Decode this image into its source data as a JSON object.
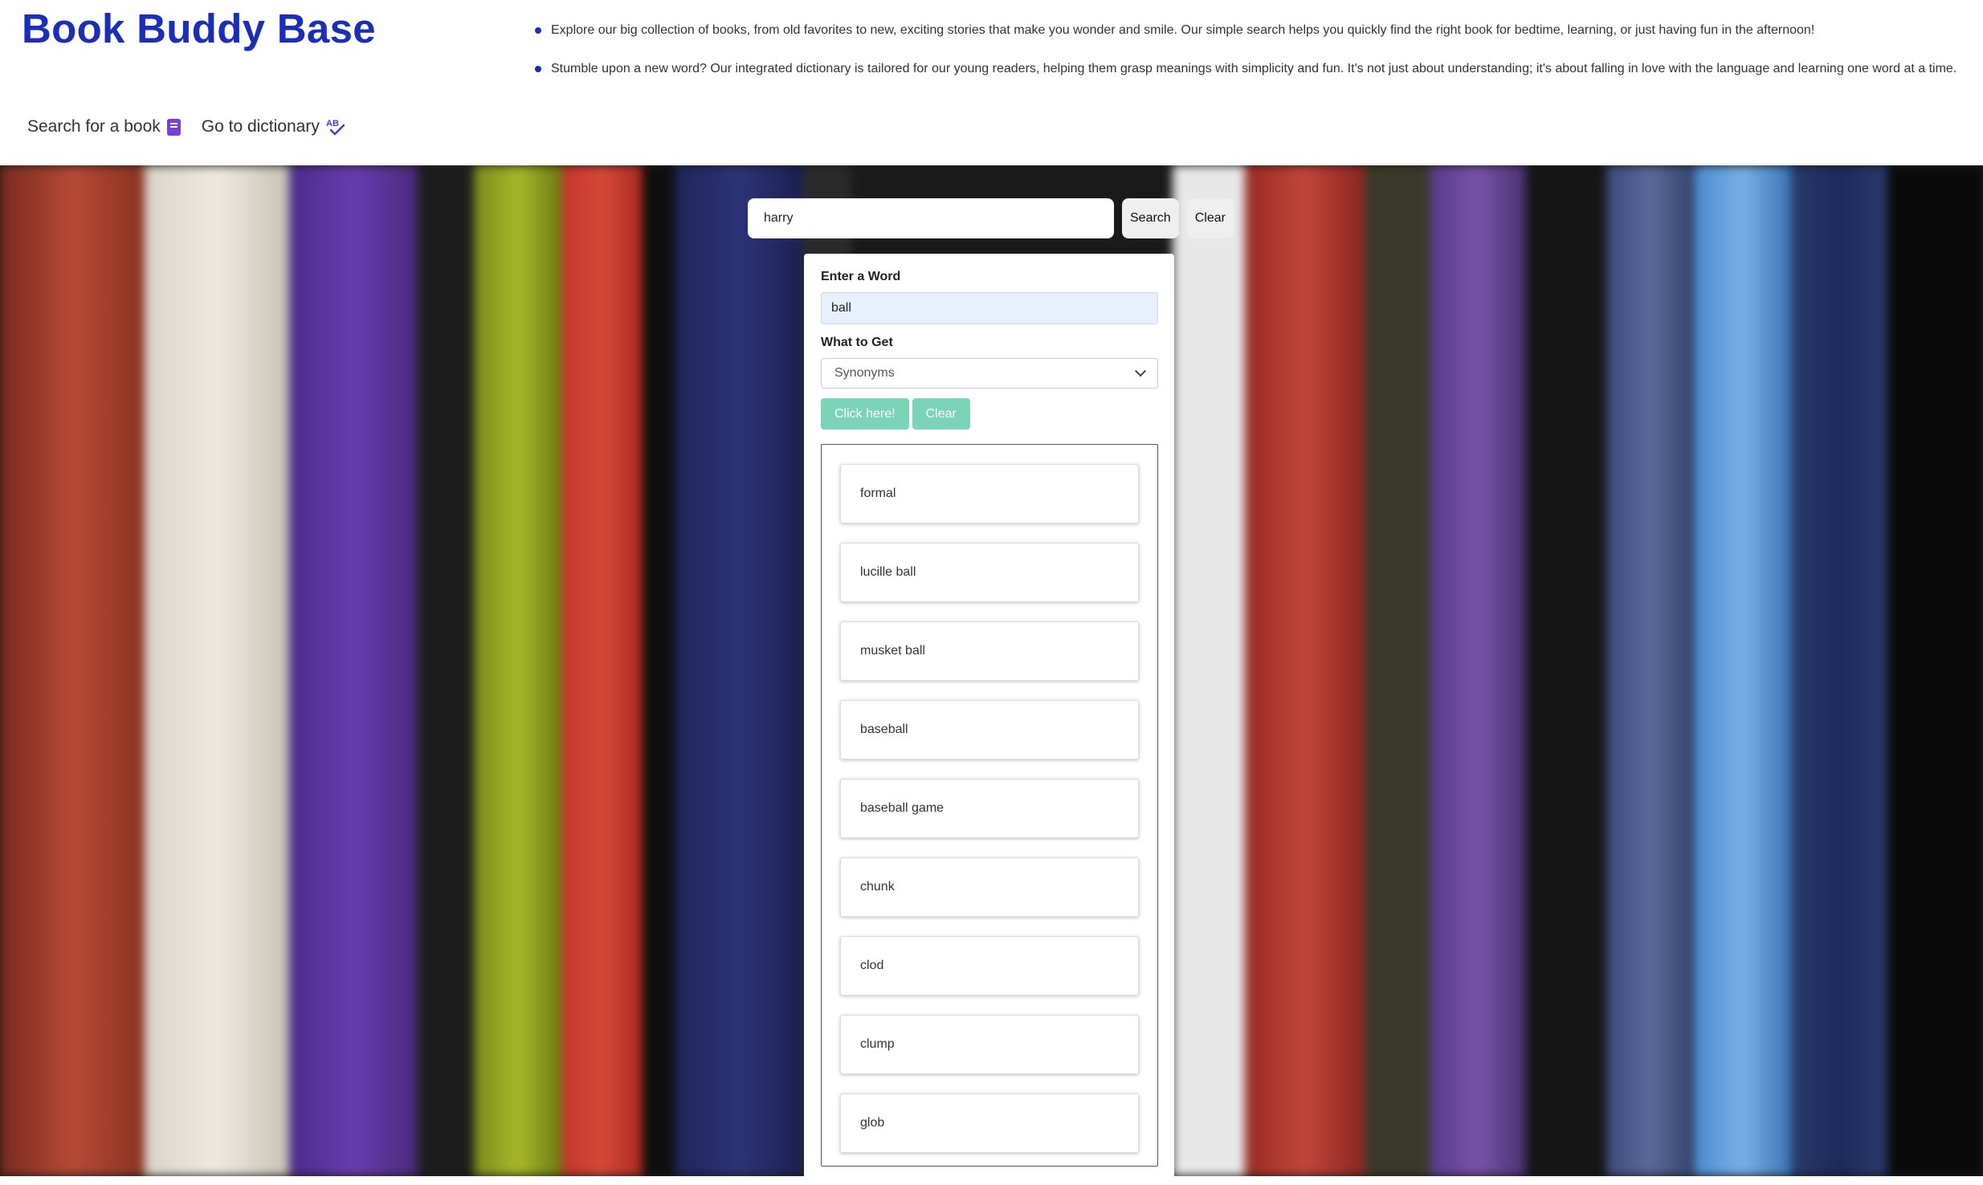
{
  "header": {
    "title": "Book Buddy Base",
    "nav": [
      {
        "label": "Search for a book",
        "icon": "book-icon"
      },
      {
        "label": "Go to dictionary",
        "icon": "spellcheck-icon"
      }
    ],
    "intro": [
      "Explore our big collection of books, from old favorites to new, exciting stories that make you wonder and smile. Our simple search helps you quickly find the right book for bedtime, learning, or just having fun in the afternoon!",
      "Stumble upon a new word? Our integrated dictionary is tailored for our young readers, helping them grasp meanings with simplicity and fun. It's not just about understanding; it's about falling in love with the language and learning one word at a time."
    ]
  },
  "search": {
    "value": "harry",
    "search_label": "Search",
    "clear_label": "Clear"
  },
  "dictionary": {
    "word_label": "Enter a Word",
    "word_value": "ball",
    "what_label": "What to Get",
    "selected_option": "Synonyms",
    "submit_label": "Click here!",
    "clear_label": "Clear",
    "results": [
      "formal",
      "lucille ball",
      "musket ball",
      "baseball",
      "baseball game",
      "chunk",
      "clod",
      "clump",
      "glob"
    ]
  },
  "colors": {
    "brand": "#1a2eb8",
    "accent_button": "#7bd3b8",
    "icon_purple": "#7b3fd6"
  }
}
